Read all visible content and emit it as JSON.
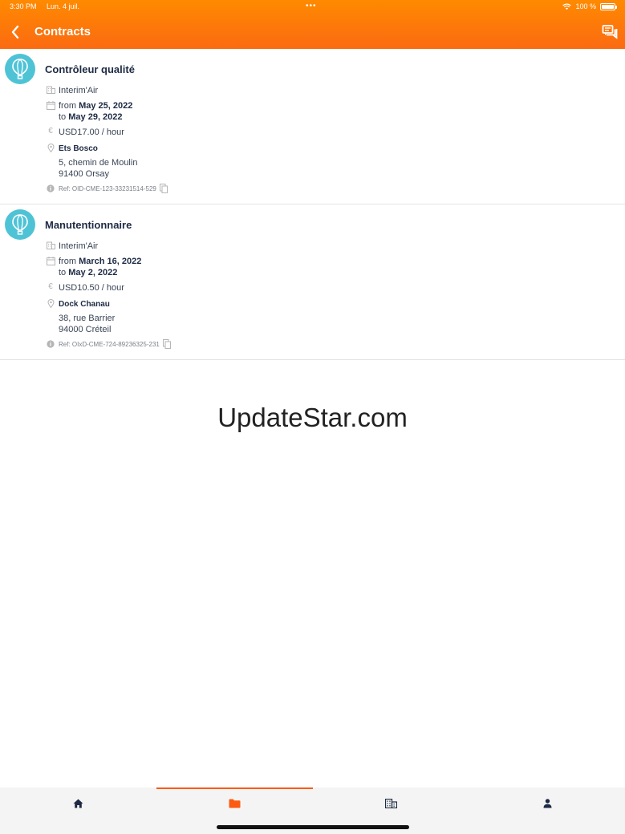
{
  "status_bar": {
    "time": "3:30 PM",
    "date": "Lun. 4 juil.",
    "dots": "•••",
    "battery": "100 %",
    "battery_level": 1.0
  },
  "header": {
    "title": "Contracts",
    "back_icon": "chevron-left-icon",
    "action_icon": "chat-icon"
  },
  "colors": {
    "header_start": "#ff8a00",
    "header_end": "#fb6a12",
    "avatar": "#4fc3d6",
    "accent": "#fb5a12",
    "title_text": "#1d2a44"
  },
  "contracts": [
    {
      "title": "Contrôleur qualité",
      "agency": "Interim'Air",
      "from_label": "from",
      "from_date": "May 25, 2022",
      "to_label": "to",
      "to_date": "May 29, 2022",
      "rate": "USD17.00 / hour",
      "company": "Ets Bosco",
      "address1": "5, chemin de Moulin",
      "address2": "91400 Orsay",
      "ref": "Ref: OID-CME-123-33231514-529"
    },
    {
      "title": "Manutentionnaire",
      "agency": "Interim'Air",
      "from_label": "from",
      "from_date": "March 16, 2022",
      "to_label": "to",
      "to_date": "May 2, 2022",
      "rate": "USD10.50 / hour",
      "company": "Dock Chanau",
      "address1": "38, rue Barrier",
      "address2": "94000 Créteil",
      "ref": "Ref: OIxD-CME-724-89236325-231"
    }
  ],
  "watermark": "UpdateStar.com",
  "tabbar": {
    "tabs": [
      {
        "icon": "home-icon",
        "active": false
      },
      {
        "icon": "folder-icon",
        "active": true
      },
      {
        "icon": "building-icon",
        "active": false
      },
      {
        "icon": "person-icon",
        "active": false
      }
    ]
  }
}
